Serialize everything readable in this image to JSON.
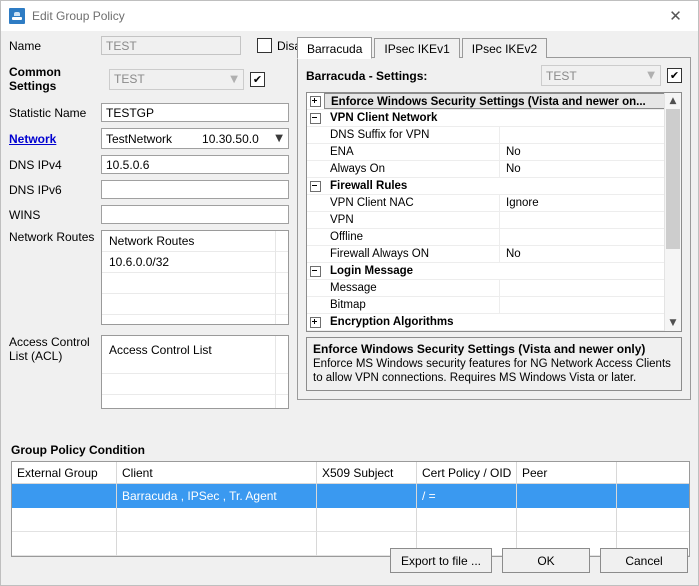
{
  "window": {
    "title": "Edit Group Policy",
    "app_icon": "printer-icon",
    "close_icon": "close-icon"
  },
  "left": {
    "name_label": "Name",
    "name_value": "TEST",
    "disabled_label": "Disabled",
    "disabled_checked": false,
    "common_settings_label": "Common Settings",
    "common_settings_value": "TEST",
    "common_settings_checked": true,
    "fields": [
      {
        "label": "Statistic Name",
        "value": "TESTGP",
        "type": "text"
      },
      {
        "label": "Network",
        "value": "TestNetwork",
        "value2": "10.30.50.0",
        "type": "combo",
        "link": true
      },
      {
        "label": "DNS IPv4",
        "value": "10.5.0.6",
        "type": "text"
      },
      {
        "label": "DNS IPv6",
        "value": "",
        "type": "text"
      },
      {
        "label": "WINS",
        "value": "",
        "type": "text"
      }
    ],
    "network_routes": {
      "label": "Network Routes",
      "header": "Network Routes",
      "items": [
        "10.6.0.0/32",
        "",
        "",
        ""
      ]
    },
    "acl": {
      "label": "Access Control List (ACL)",
      "header": "Access Control List",
      "items": [
        "",
        "",
        ""
      ]
    }
  },
  "right": {
    "tabs": [
      {
        "label": "Barracuda",
        "active": true
      },
      {
        "label": "IPsec IKEv1",
        "active": false
      },
      {
        "label": "IPsec IKEv2",
        "active": false
      }
    ],
    "settings_header": "Barracuda - Settings:",
    "settings_combo_value": "TEST",
    "settings_checked": true,
    "grid_rows": [
      {
        "kind": "cat",
        "expander": "plus",
        "name": "Enforce Windows Security Settings (Vista and newer on...",
        "value": "",
        "selected": true
      },
      {
        "kind": "cat",
        "expander": "minus",
        "name": "VPN Client Network",
        "value": "",
        "selected": false
      },
      {
        "kind": "prop",
        "expander": "",
        "name": "DNS Suffix for VPN",
        "value": "",
        "selected": false
      },
      {
        "kind": "prop",
        "expander": "",
        "name": "ENA",
        "value": "No",
        "selected": false
      },
      {
        "kind": "prop",
        "expander": "",
        "name": "Always On",
        "value": "No",
        "selected": false
      },
      {
        "kind": "cat",
        "expander": "minus",
        "name": "Firewall Rules",
        "value": "",
        "selected": false
      },
      {
        "kind": "prop",
        "expander": "",
        "name": "VPN Client NAC",
        "value": "Ignore",
        "selected": false
      },
      {
        "kind": "prop",
        "expander": "",
        "name": "VPN",
        "value": "",
        "selected": false
      },
      {
        "kind": "prop",
        "expander": "",
        "name": "Offline",
        "value": "",
        "selected": false
      },
      {
        "kind": "prop",
        "expander": "",
        "name": "Firewall Always ON",
        "value": "No",
        "selected": false
      },
      {
        "kind": "cat",
        "expander": "minus",
        "name": "Login Message",
        "value": "",
        "selected": false
      },
      {
        "kind": "prop",
        "expander": "",
        "name": "Message",
        "value": "",
        "selected": false
      },
      {
        "kind": "prop",
        "expander": "",
        "name": "Bitmap",
        "value": "",
        "selected": false
      },
      {
        "kind": "cat",
        "expander": "plus",
        "name": "Encryption Algorithms",
        "value": "",
        "selected": false
      }
    ],
    "description": {
      "title": "Enforce Windows Security Settings (Vista and newer only)",
      "text": "Enforce MS Windows security features for NG Network Access Clients to allow VPN connections. Requires MS Windows Vista or later."
    },
    "scroll_up_icon": "chevron-up-icon",
    "scroll_down_icon": "chevron-down-icon"
  },
  "group_policy_condition": {
    "title": "Group Policy Condition",
    "columns": [
      "External Group",
      "Client",
      "X509 Subject",
      "Cert Policy / OID",
      "Peer",
      ""
    ],
    "rows": [
      {
        "selected": true,
        "cells": [
          "",
          "Barracuda , IPSec , Tr. Agent",
          "",
          "/ =",
          "",
          ""
        ]
      },
      {
        "selected": false,
        "cells": [
          "",
          "",
          "",
          "",
          "",
          ""
        ]
      },
      {
        "selected": false,
        "cells": [
          "",
          "",
          "",
          "",
          "",
          ""
        ]
      }
    ]
  },
  "footer": {
    "buttons": [
      {
        "label": "Export to file ..."
      },
      {
        "label": "OK"
      },
      {
        "label": "Cancel"
      }
    ]
  },
  "colors": {
    "selection_blue": "#3a99f0",
    "link_blue": "#0000d0",
    "window_bg": "#f0f0f0"
  }
}
